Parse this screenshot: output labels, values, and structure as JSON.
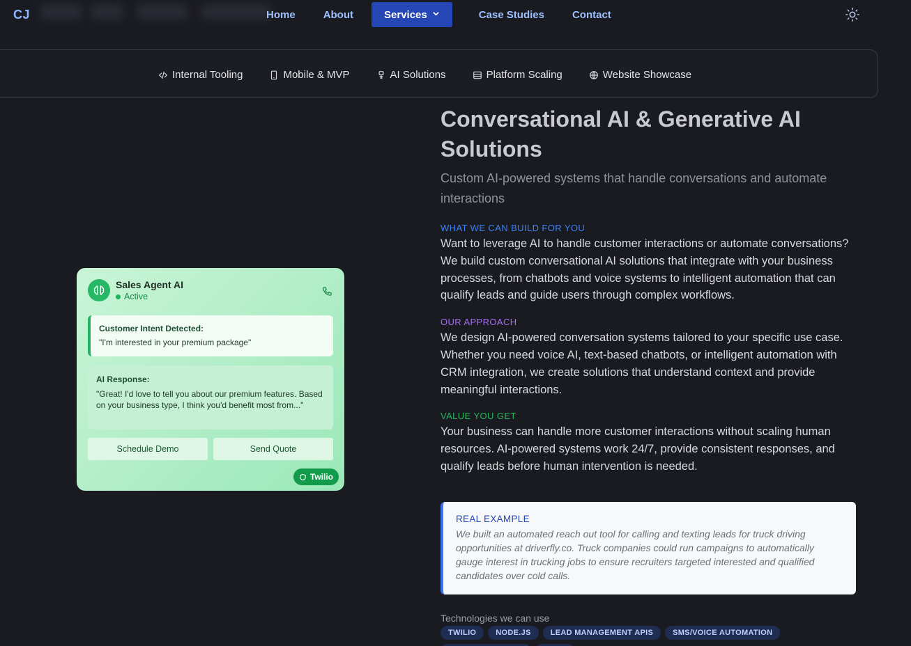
{
  "nav": {
    "logo": "CJ",
    "links": [
      "Home",
      "About",
      "Services",
      "Case Studies",
      "Contact"
    ],
    "active": "Services"
  },
  "subnav": {
    "items": [
      "Internal Tooling",
      "Mobile & MVP",
      "AI Solutions",
      "Platform Scaling",
      "Website Showcase"
    ]
  },
  "card": {
    "agent_name": "Sales Agent AI",
    "status": "Active",
    "intent_title": "Customer Intent Detected:",
    "intent_text": "\"I'm interested in your premium package\"",
    "response_title": "AI Response:",
    "response_text": "\"Great! I'd love to tell you about our premium features. Based on your business type, I think you'd benefit most from...\"",
    "buttons": [
      "Schedule Demo",
      "Send Quote"
    ],
    "badge": "Twilio"
  },
  "content": {
    "title": "Conversational AI & Generative AI Solutions",
    "subtitle": "Custom AI-powered systems that handle conversations and automate interactions",
    "sections": [
      {
        "label": "WHAT WE CAN BUILD FOR YOU",
        "text": "Want to leverage AI to handle customer interactions or automate conversations? We build custom conversational AI solutions that integrate with your business processes, from chatbots and voice systems to intelligent automation that can qualify leads and guide users through complex workflows."
      },
      {
        "label": "OUR APPROACH",
        "text": "We design AI-powered conversation systems tailored to your specific use case. Whether you need voice AI, text-based chatbots, or intelligent automation with CRM integration, we create solutions that understand context and provide meaningful interactions."
      },
      {
        "label": "VALUE YOU GET",
        "text": "Your business can handle more customer interactions without scaling human resources. AI-powered systems work 24/7, provide consistent responses, and qualify leads before human intervention is needed."
      }
    ],
    "example_label": "REAL EXAMPLE",
    "example_text": "We built an automated reach out tool for calling and texting leads for truck driving opportunities at driverfly.co. Truck companies could run campaigns to automatically gauge interest in trucking jobs to ensure recruiters targeted interested and qualified candidates over cold calls.",
    "tech_label": "Technologies we can use",
    "tags": [
      "TWILIO",
      "NODE.JS",
      "LEAD MANAGEMENT APIS",
      "SMS/VOICE AUTOMATION"
    ]
  },
  "colors": {
    "accent": "#2447b5",
    "card_green": "#26b865",
    "background": "#1a1b20"
  },
  "icons": [
    "sun-icon",
    "code-icon",
    "phone-icon",
    "bot-icon",
    "layout-icon",
    "globe-icon",
    "brain-icon",
    "call-icon",
    "shield-icon"
  ]
}
